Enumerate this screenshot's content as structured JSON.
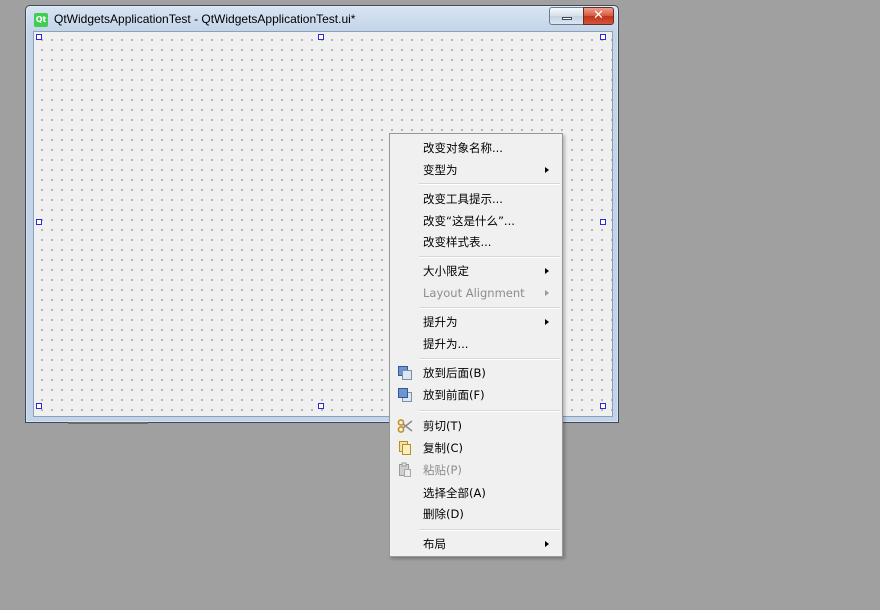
{
  "window": {
    "icon_text": "Qt",
    "title": "QtWidgetsApplicationTest - QtWidgetsApplicationTest.ui*",
    "close_glyph": "✕"
  },
  "context_menu": {
    "items": [
      {
        "label": "改变对象名称...",
        "submenu": false,
        "enabled": true
      },
      {
        "label": "变型为",
        "submenu": true,
        "enabled": true
      },
      {
        "label": "改变工具提示...",
        "submenu": false,
        "enabled": true
      },
      {
        "label": "改变“这是什么”...",
        "submenu": false,
        "enabled": true
      },
      {
        "label": "改变样式表...",
        "submenu": false,
        "enabled": true
      },
      {
        "label": "大小限定",
        "submenu": true,
        "enabled": true
      },
      {
        "label": "Layout Alignment",
        "submenu": true,
        "enabled": false
      },
      {
        "label": "提升为",
        "submenu": true,
        "enabled": true
      },
      {
        "label": "提升为...",
        "submenu": false,
        "enabled": true
      },
      {
        "label": "放到后面(B)",
        "submenu": false,
        "enabled": true,
        "icon": "send-to-back-icon"
      },
      {
        "label": "放到前面(F)",
        "submenu": false,
        "enabled": true,
        "icon": "bring-to-front-icon"
      },
      {
        "label": "剪切(T)",
        "submenu": false,
        "enabled": true,
        "icon": "scissors-icon"
      },
      {
        "label": "复制(C)",
        "submenu": false,
        "enabled": true,
        "icon": "copy-icon"
      },
      {
        "label": "粘贴(P)",
        "submenu": false,
        "enabled": false,
        "icon": "paste-icon"
      },
      {
        "label": "选择全部(A)",
        "submenu": false,
        "enabled": true
      },
      {
        "label": "删除(D)",
        "submenu": false,
        "enabled": true
      },
      {
        "label": "布局",
        "submenu": true,
        "enabled": true
      }
    ]
  },
  "colors": {
    "desktop": "#a0a0a0",
    "selection_handle": "#2b2bd1",
    "qt_brand": "#41cd52"
  }
}
